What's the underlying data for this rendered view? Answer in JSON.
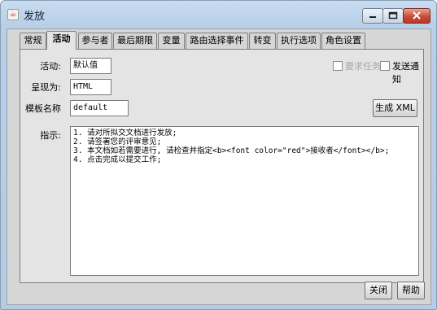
{
  "window": {
    "title": "发放"
  },
  "tabs": [
    {
      "label": "常规"
    },
    {
      "label": "活动",
      "active": true
    },
    {
      "label": "参与者"
    },
    {
      "label": "最后期限"
    },
    {
      "label": "变量"
    },
    {
      "label": "路由选择事件"
    },
    {
      "label": "转变"
    },
    {
      "label": "执行选项"
    },
    {
      "label": "角色设置"
    }
  ],
  "form": {
    "activity_label": "活动:",
    "activity_value": "默认值",
    "present_as_label": "呈现为:",
    "present_as_value": "HTML",
    "template_name_label": "模板名称",
    "template_name_value": "default",
    "instructions_label": "指示:",
    "instructions_lines": [
      "1. 请对所拟交文档进行发放;",
      "2. 请签署您的评审意见;",
      "3. 本文档如若需要进行, 请检查并指定<b><font color=\"red\">接收者</font></b>;",
      "4. 点击完成以提交工作;"
    ]
  },
  "options": {
    "required_task_label": "要求任务",
    "required_task_checked": false,
    "send_notification_label": "发送通知",
    "send_notification_checked": false
  },
  "buttons": {
    "generate_xml": "生成 XML",
    "close": "关闭",
    "help": "帮助"
  },
  "icons": {
    "app": "java-cup-icon",
    "minimize": "minimize-icon",
    "maximize": "maximize-icon",
    "close": "close-x-icon"
  }
}
